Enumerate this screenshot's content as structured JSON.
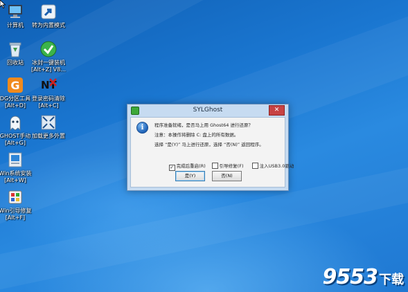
{
  "desktop": {
    "icons": [
      {
        "name": "computer",
        "label": "计算机"
      },
      {
        "name": "switch-mode",
        "label": "转为内置模式"
      },
      {
        "name": "recycle-bin",
        "label": "回收站"
      },
      {
        "name": "one-key-install",
        "label": "冰封一键装机\n[Alt+Z] V8..."
      },
      {
        "name": "dg-partition",
        "label": "DG分区工具\n[Alt+D]"
      },
      {
        "name": "password-clear",
        "label": "登录密码清除\n[Alt+C]"
      },
      {
        "name": "ghost-manual",
        "label": "GHOST手动\n[Alt+G]"
      },
      {
        "name": "load-more",
        "label": "加载更多外置"
      },
      {
        "name": "win-install",
        "label": "Win系统安装\n[Alt+W]"
      },
      {
        "name": "win-boot-repair",
        "label": "Win引导修复\n[Alt+F]"
      }
    ]
  },
  "dialog": {
    "title": "SYLGhost",
    "close": "✕",
    "line1": "程序准备就绪，是否马上用 Ghost64 进行还原？",
    "line2": "注意：本操作将删除 C: 盘上的所有数据。",
    "line3": "选择 “是(Y)” 马上进行还原，选择 “否(N)” 返回程序。",
    "checkboxes": [
      {
        "label": "完成后重启(R)",
        "checked": true
      },
      {
        "label": "引导修复(F)",
        "checked": false
      },
      {
        "label": "注入USB3.0驱动",
        "checked": false
      }
    ],
    "yes_button": "是(Y)",
    "no_button": "否(N)"
  },
  "watermark": {
    "digits": "9553",
    "text": "下载"
  },
  "colors": {
    "desktop": "#1f7fd6",
    "dialog_frame": "#c6dbf1",
    "close": "#c74343"
  }
}
